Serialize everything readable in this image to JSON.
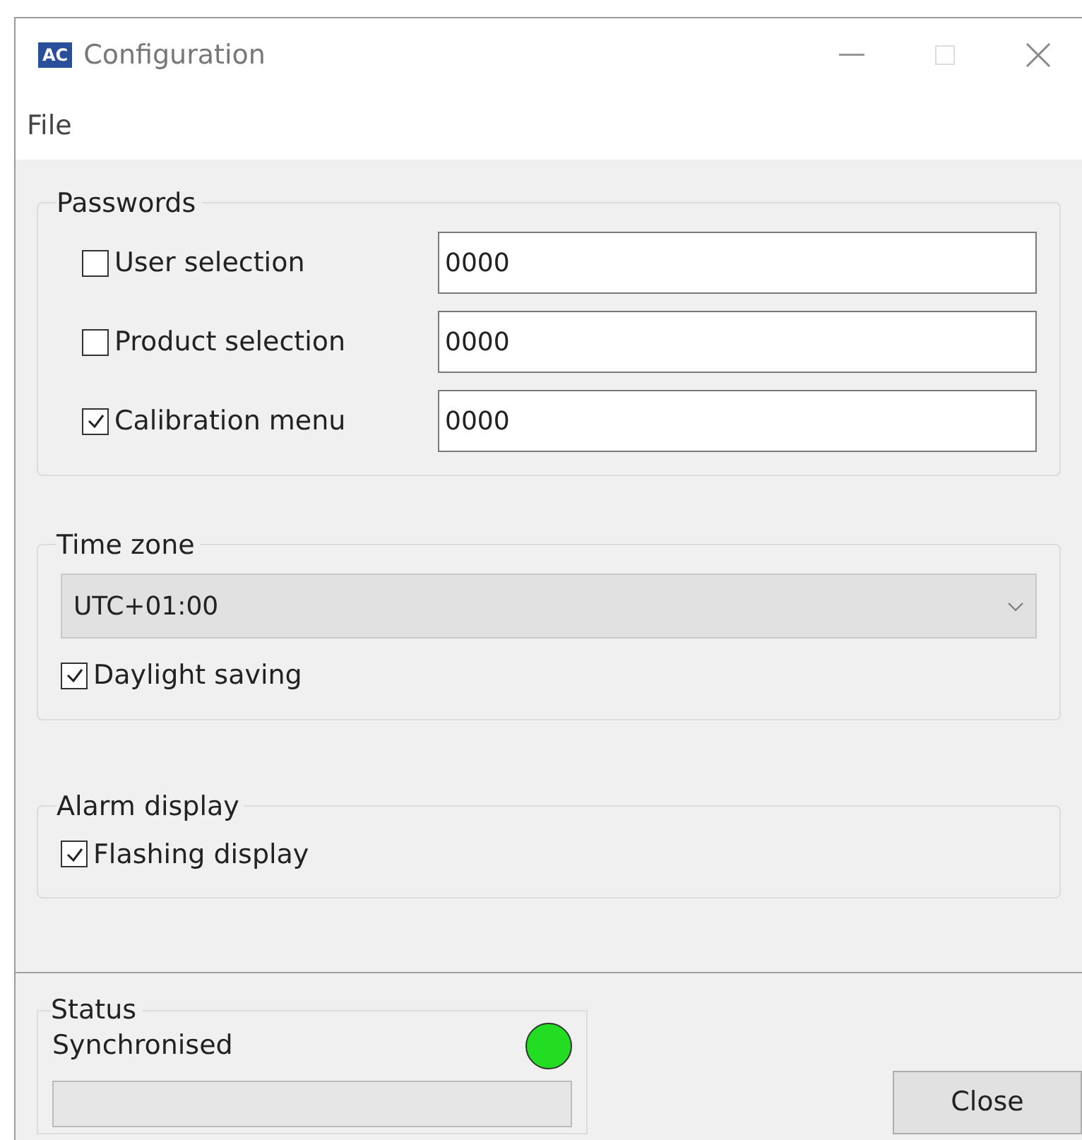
{
  "window": {
    "logo": "AC",
    "title": "Configuration"
  },
  "menu": [
    "File"
  ],
  "passwords": {
    "title": "Passwords",
    "rows": [
      {
        "label": "User selection",
        "checked": false,
        "value": "0000"
      },
      {
        "label": "Product selection",
        "checked": false,
        "value": "0000"
      },
      {
        "label": "Calibration menu",
        "checked": true,
        "value": "0000"
      }
    ]
  },
  "time_zone": {
    "title": "Time zone",
    "value": "UTC+01:00",
    "options": [
      {
        "label": "Daylight saving",
        "checked": true
      }
    ]
  },
  "alarm_display": {
    "title": "Alarm display",
    "options": [
      {
        "label": "Flashing display",
        "checked": true
      }
    ]
  },
  "status": {
    "title": "Status",
    "text": "Synchronised",
    "color": "#22dd22",
    "level": 0
  },
  "buttons": [
    "Close"
  ]
}
